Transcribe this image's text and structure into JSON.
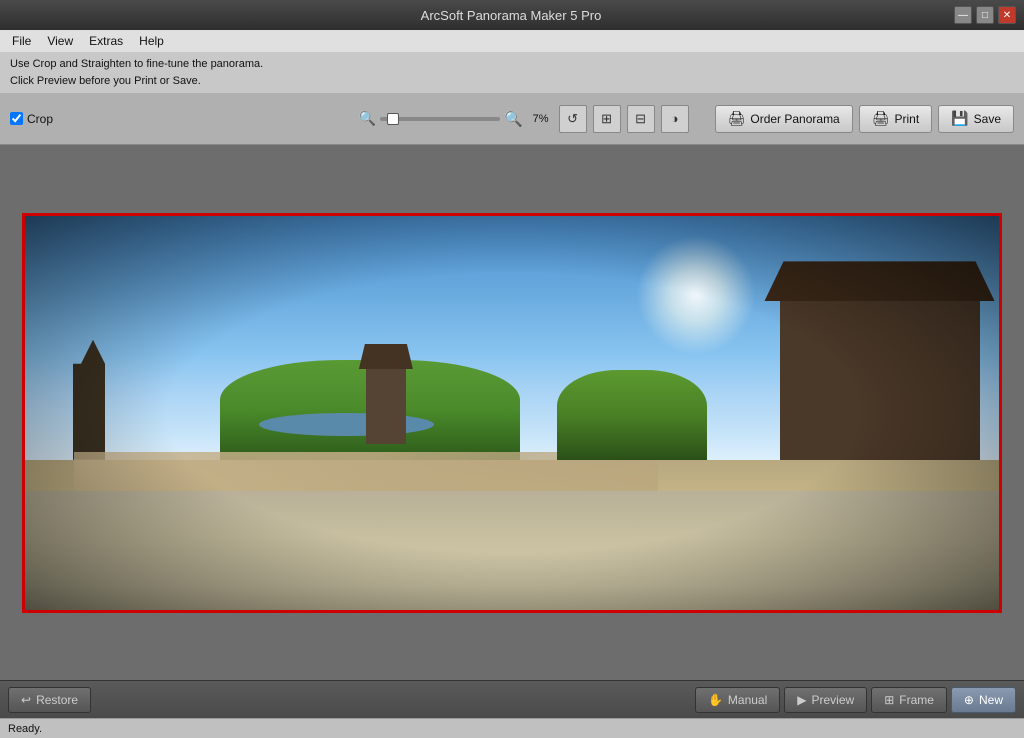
{
  "app": {
    "title": "ArcSoft Panorama Maker 5 Pro"
  },
  "window_controls": {
    "minimize": "—",
    "maximize": "□",
    "close": "✕"
  },
  "menu": {
    "items": [
      "File",
      "View",
      "Extras",
      "Help"
    ]
  },
  "info": {
    "line1": "Use Crop and Straighten to fine-tune the panorama.",
    "line2": "Click Preview before you Print or Save."
  },
  "toolbar": {
    "crop_label": "Crop",
    "zoom_percent": "7%",
    "order_btn": "Order Panorama",
    "print_btn": "Print",
    "save_btn": "Save"
  },
  "bottom": {
    "restore_btn": "Restore",
    "manual_btn": "Manual",
    "preview_btn": "Preview",
    "frame_btn": "Frame",
    "new_btn": "New"
  },
  "status": {
    "text": "Ready."
  }
}
